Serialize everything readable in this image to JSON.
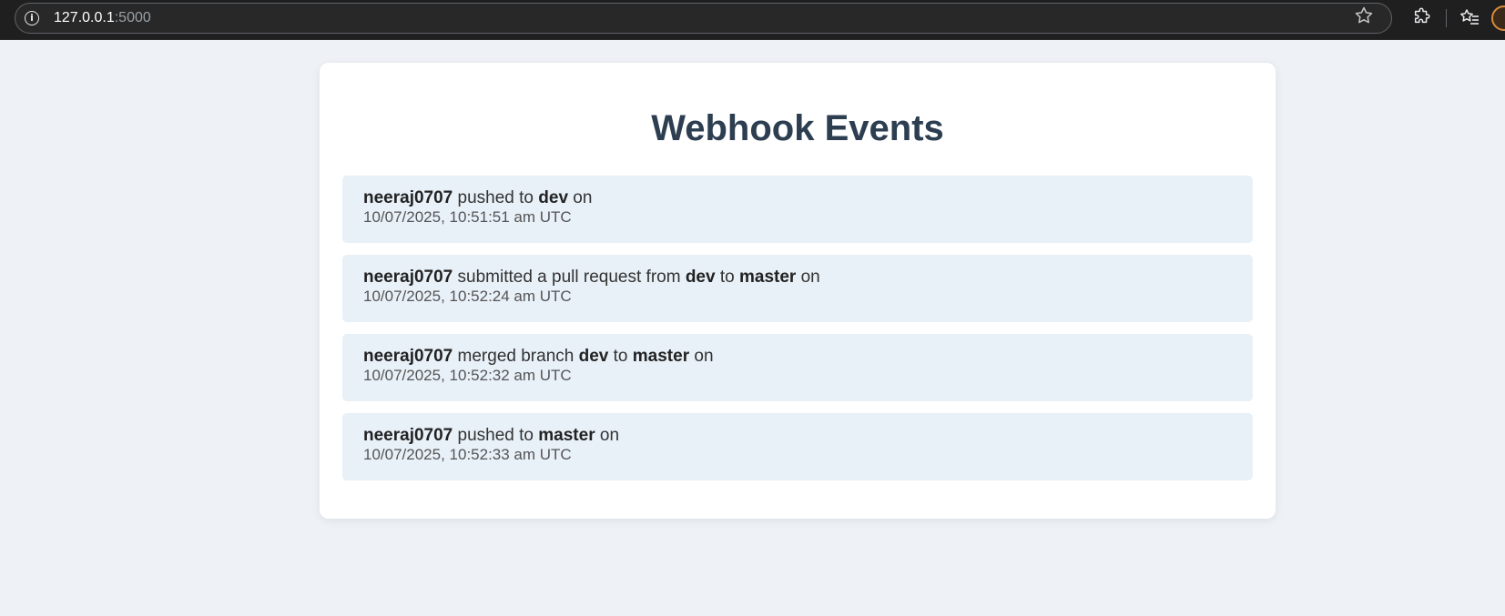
{
  "browser": {
    "url_host": "127.0.0.1",
    "url_port": ":5000",
    "info_icon": "info-icon",
    "bookmark_icon": "star-icon",
    "extensions_icon": "puzzle-icon",
    "favorites_icon": "favorites-list-icon",
    "profile_icon": "profile-avatar-icon",
    "accent": "#d98a3a"
  },
  "page": {
    "title": "Webhook Events",
    "title_color": "#2c3e50",
    "background": "#eef2f7",
    "item_background": "#e8f0f8"
  },
  "events": [
    {
      "author": "neeraj0707",
      "action": " pushed to ",
      "from_branch": "",
      "connector": "",
      "to_branch": "dev",
      "suffix": " on",
      "timestamp": "10/07/2025, 10:51:51 am UTC"
    },
    {
      "author": "neeraj0707",
      "action": " submitted a pull request from ",
      "from_branch": "dev",
      "connector": " to ",
      "to_branch": "master",
      "suffix": " on",
      "timestamp": "10/07/2025, 10:52:24 am UTC"
    },
    {
      "author": "neeraj0707",
      "action": " merged branch ",
      "from_branch": "dev",
      "connector": " to ",
      "to_branch": "master",
      "suffix": " on",
      "timestamp": "10/07/2025, 10:52:32 am UTC"
    },
    {
      "author": "neeraj0707",
      "action": " pushed to ",
      "from_branch": "",
      "connector": "",
      "to_branch": "master",
      "suffix": " on",
      "timestamp": "10/07/2025, 10:52:33 am UTC"
    }
  ]
}
